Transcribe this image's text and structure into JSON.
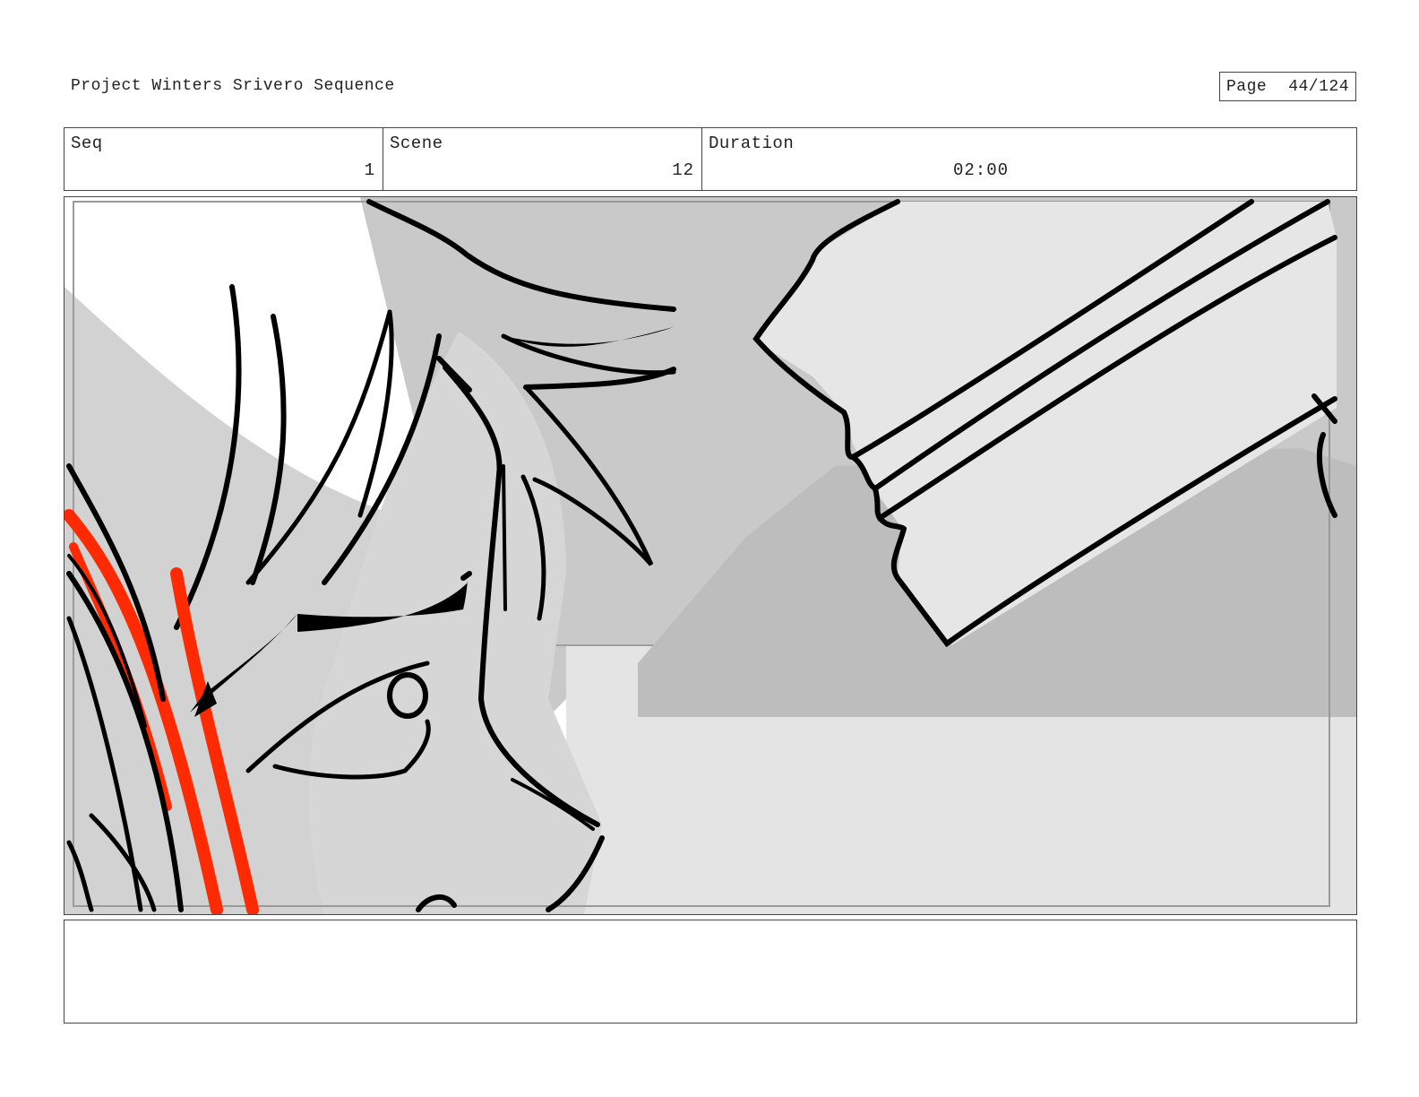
{
  "header": {
    "project_title": "Project Winters Srivero Sequence",
    "page_label": "Page",
    "page_number": "44/124"
  },
  "info": {
    "seq_label": "Seq",
    "seq_value": "1",
    "scene_label": "Scene",
    "scene_value": "12",
    "duration_label": "Duration",
    "duration_value": "02:00"
  },
  "panel": {
    "drawing": "storyboard-sketch",
    "colors": {
      "ink": "#000000",
      "accent": "#ff2a00",
      "wall": "#c8c8c8",
      "floor": "#e3e3e3"
    }
  },
  "notes": {
    "text": ""
  }
}
